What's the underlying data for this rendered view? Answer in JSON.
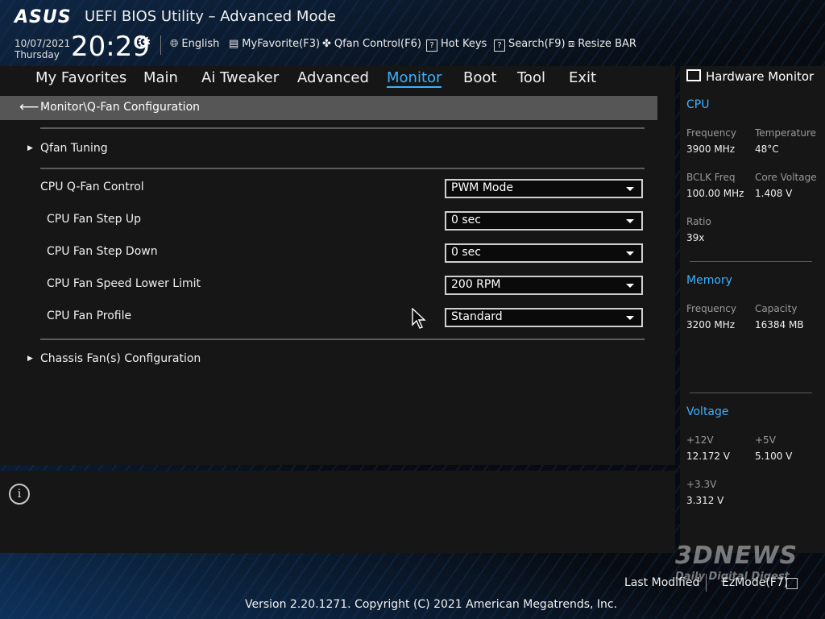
{
  "header": {
    "logo": "ASUS",
    "title": "UEFI BIOS Utility – Advanced Mode",
    "date": "10/07/2021",
    "day": "Thursday",
    "time": "20:29"
  },
  "toolbar": {
    "language": "English",
    "myfavorite": "MyFavorite(F3)",
    "qfan": "Qfan Control(F6)",
    "hotkeys": "Hot Keys",
    "search": "Search(F9)",
    "resizebar": "Resize BAR"
  },
  "menu": {
    "items": [
      "My Favorites",
      "Main",
      "Ai Tweaker",
      "Advanced",
      "Monitor",
      "Boot",
      "Tool",
      "Exit"
    ],
    "active": "Monitor"
  },
  "breadcrumb": "Monitor\\Q-Fan Configuration",
  "submenus": {
    "qfan_tuning": "Qfan Tuning",
    "chassis": "Chassis Fan(s) Configuration"
  },
  "settings": [
    {
      "label": "CPU Q-Fan Control",
      "value": "PWM Mode"
    },
    {
      "label": "CPU Fan Step Up",
      "value": "0 sec"
    },
    {
      "label": "CPU Fan Step Down",
      "value": "0 sec"
    },
    {
      "label": "CPU Fan Speed Lower Limit",
      "value": "200 RPM"
    },
    {
      "label": "CPU Fan Profile",
      "value": "Standard"
    }
  ],
  "info_icon": "i",
  "hardware_monitor": {
    "title": "Hardware Monitor",
    "cpu": {
      "heading": "CPU",
      "frequency_label": "Frequency",
      "frequency": "3900 MHz",
      "temperature_label": "Temperature",
      "temperature": "48°C",
      "bclk_label": "BCLK Freq",
      "bclk": "100.00 MHz",
      "core_voltage_label": "Core Voltage",
      "core_voltage": "1.408 V",
      "ratio_label": "Ratio",
      "ratio": "39x"
    },
    "memory": {
      "heading": "Memory",
      "frequency_label": "Frequency",
      "frequency": "3200 MHz",
      "capacity_label": "Capacity",
      "capacity": "16384 MB"
    },
    "voltage": {
      "heading": "Voltage",
      "v12_label": "+12V",
      "v12": "12.172 V",
      "v5_label": "+5V",
      "v5": "5.100 V",
      "v33_label": "+3.3V",
      "v33": "3.312 V"
    }
  },
  "footer": {
    "version": "Version 2.20.1271. Copyright (C) 2021 American Megatrends, Inc.",
    "last_modified": "Last Modified",
    "ezmode": "EzMode(F7)"
  },
  "watermark": {
    "brand": "3DNEWS",
    "tagline": "Daily Digital Digest"
  },
  "colors": {
    "accent": "#3cb0ff",
    "panel": "#161616",
    "breadcrumb_bar": "#565656"
  },
  "icons": {
    "settings": "gear-icon",
    "language": "globe-icon",
    "favorite": "keyboard-icon",
    "qfan": "fan-icon",
    "hotkeys": "question-icon",
    "search": "question-icon",
    "resizebar": "chip-icon",
    "back": "back-arrow-icon",
    "info": "info-icon",
    "monitor": "monitor-icon",
    "cursor": "mouse-cursor-icon"
  }
}
